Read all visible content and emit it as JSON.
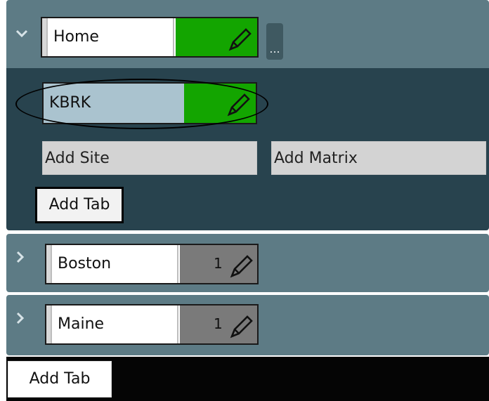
{
  "groups": [
    {
      "name": "Home",
      "expanded": true,
      "color": "#13a500",
      "more_label": "...",
      "sites": [
        {
          "name": "KBRK",
          "color": "#13a500",
          "highlighted": true
        }
      ],
      "add_site_label": "Add Site",
      "add_matrix_label": "Add Matrix",
      "add_tab_label": "Add Tab"
    },
    {
      "name": "Boston",
      "expanded": false,
      "count": "1",
      "color": "#7a7a7a"
    },
    {
      "name": "Maine",
      "expanded": false,
      "count": "1",
      "color": "#7a7a7a"
    }
  ],
  "footer": {
    "add_tab_label": "Add Tab"
  },
  "icons": {
    "expanded_chevron": "chevron-down-icon",
    "collapsed_chevron": "chevron-right-icon",
    "edit": "pencil-icon"
  },
  "colors": {
    "header_bg": "#5d7b85",
    "expanded_bg": "#28434e",
    "accent_green": "#13a500",
    "site_bg": "#aac3cf",
    "footer_bg": "#050505"
  }
}
